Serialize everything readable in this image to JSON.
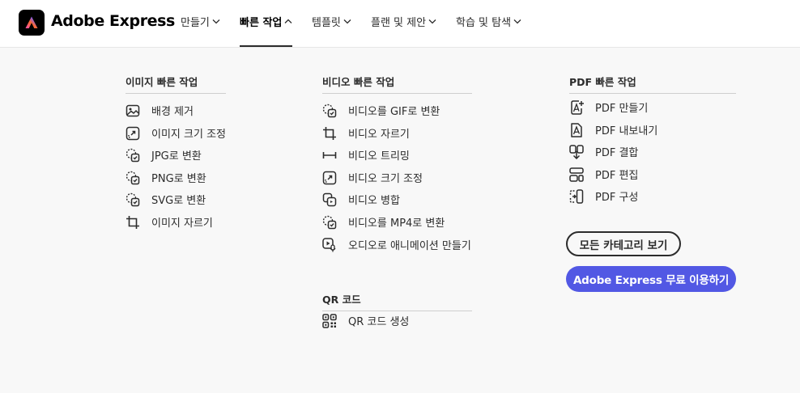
{
  "header": {
    "brand": "Adobe Express",
    "nav": [
      {
        "label": "만들기"
      },
      {
        "label": "빠른 작업"
      },
      {
        "label": "템플릿"
      },
      {
        "label": "플랜 및 제안"
      },
      {
        "label": "학습 및 탐색"
      }
    ]
  },
  "columns": {
    "image": {
      "heading": "이미지 빠른 작업",
      "items": [
        "배경 제거",
        "이미지 크기 조정",
        "JPG로 변환",
        "PNG로 변환",
        "SVG로 변환",
        "이미지 자르기"
      ]
    },
    "video": {
      "heading": "비디오 빠른 작업",
      "items": [
        "비디오를 GIF로 변환",
        "비디오 자르기",
        "비디오 트리밍",
        "비디오 크기 조정",
        "비디오 병합",
        "비디오를 MP4로 변환",
        "오디오로 애니메이션 만들기"
      ]
    },
    "qr": {
      "heading": "QR 코드",
      "items": [
        "QR 코드 생성"
      ]
    },
    "pdf": {
      "heading": "PDF 빠른 작업",
      "items": [
        "PDF 만들기",
        "PDF 내보내기",
        "PDF 결합",
        "PDF 편집",
        "PDF 구성"
      ]
    }
  },
  "buttons": {
    "all_categories": "모든 카테고리 보기",
    "cta": "Adobe Express 무료 이용하기"
  },
  "colors": {
    "cta_background": "#5258e4",
    "page_background": "#f8f8f8"
  }
}
